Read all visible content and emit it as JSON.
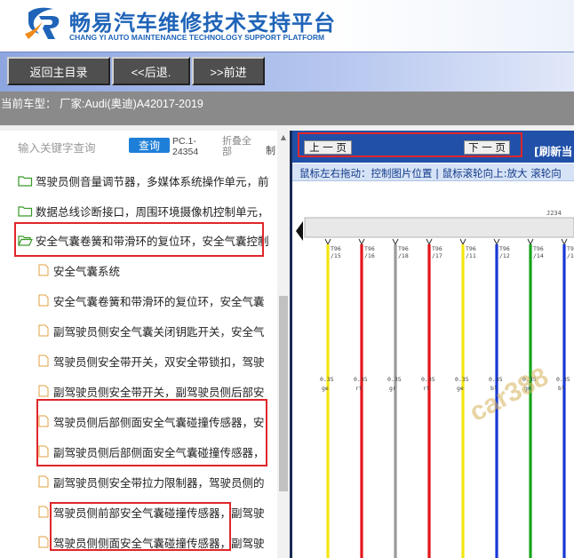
{
  "header": {
    "title_cn": "畅易汽车维修技术支持平台",
    "title_en": "CHANG YI AUTO MAINTENANCE TECHNOLOGY SUPPORT PLATFORM",
    "logo_icon": "cy-logo-icon"
  },
  "nav": {
    "back_label": "返回主目录",
    "prev_label": "<<后退.",
    "next_label": ">>前进"
  },
  "vehicle": {
    "text": "当前车型： 厂家:Audi(奥迪)A42017-2019"
  },
  "search": {
    "placeholder": "输入关键字查询",
    "query_label": "查询",
    "code": "PC.1-24354",
    "collapse_label": "折叠全部",
    "cut_label": "制"
  },
  "tree": {
    "folders": [
      {
        "label": "驾驶员侧音量调节器，多媒体系统操作单元，前",
        "open": false
      },
      {
        "label": "数据总线诊断接口，周围环境摄像机控制单元，",
        "open": false
      },
      {
        "label": "安全气囊卷簧和带滑环的复位环，安全气囊控制",
        "open": true
      }
    ],
    "files": [
      "安全气囊系统",
      "安全气囊卷簧和带滑环的复位环，安全气囊",
      "副驾驶员侧安全气囊关闭钥匙开关，安全气",
      "驾驶员侧安全带开关，双安全带锁扣，驾驶",
      "副驾驶员侧安全带开关，副驾驶员侧后部安",
      "驾驶员侧后部侧面安全气囊碰撞传感器，安",
      "副驾驶员侧后部侧面安全气囊碰撞传感器，",
      "副驾驶员侧安全带拉力限制器，驾驶员侧的",
      "驾驶员侧前部安全气囊碰撞传感器，副驾驶",
      "驾驶员侧侧面安全气囊碰撞传感器，副驾驶"
    ]
  },
  "viewer": {
    "prev_page": "上 一 页",
    "next_page": "下 一 页",
    "refresh": "[刷新当",
    "hint": "鼠标左右拖动：控制图片位置 | 鼠标滚轮向上:放大  滚轮向",
    "connector": "J234",
    "watermark": "car388",
    "wires": [
      {
        "pin_a": "T96",
        "pin_b": "/15",
        "gauge": "0.35",
        "code": "ge",
        "color": "#f5e50e"
      },
      {
        "pin_a": "T96",
        "pin_b": "/16",
        "gauge": "0.35",
        "code": "rt",
        "color": "#e2161b"
      },
      {
        "pin_a": "T96",
        "pin_b": "/18",
        "gauge": "0.35",
        "code": "gr",
        "color": "#9a9a9a"
      },
      {
        "pin_a": "T96",
        "pin_b": "/17",
        "gauge": "0.35",
        "code": "rt",
        "color": "#e2161b"
      },
      {
        "pin_a": "T96",
        "pin_b": "/11",
        "gauge": "0.35",
        "code": "ge",
        "color": "#f5e50e"
      },
      {
        "pin_a": "T96",
        "pin_b": "/12",
        "gauge": "0.35",
        "code": "bl",
        "color": "#1738d6"
      },
      {
        "pin_a": "T96",
        "pin_b": "/14",
        "gauge": "0.35",
        "code": "gn",
        "color": "#17a31c"
      },
      {
        "pin_a": "T96",
        "pin_b": "/13",
        "gauge": "0.35",
        "code": "bl",
        "color": "#1738d6"
      }
    ]
  },
  "colors": {
    "brand_blue": "#1f64b8",
    "highlight_red": "#e0262a",
    "page_bar": "#2050a8"
  }
}
